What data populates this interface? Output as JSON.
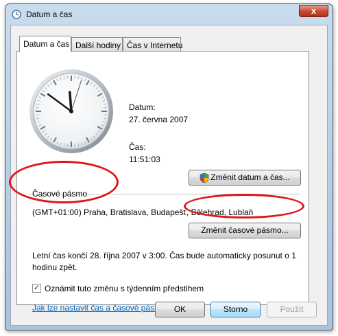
{
  "window": {
    "title": "Datum a čas",
    "close_glyph": "x"
  },
  "tabs": [
    {
      "label": "Datum a čas",
      "active": true
    },
    {
      "label": "Další hodiny",
      "active": false
    },
    {
      "label": "Čas v Internetu",
      "active": false
    }
  ],
  "clock": {
    "hour": 11,
    "minute": 51,
    "second": 3
  },
  "date": {
    "label": "Datum:",
    "value": "27. června 2007"
  },
  "time": {
    "label": "Čas:",
    "value": "11:51:03"
  },
  "change_datetime_button": "Změnit datum a čas...",
  "timezone": {
    "heading": "Časové pásmo",
    "value": "(GMT+01:00) Praha, Bratislava, Budapešť, Bělehrad, Lublaň",
    "change_button": "Změnit časové pásmo..."
  },
  "dst_notice": {
    "line1": "Letní čas končí 28. října 2007 v 3:00. Čas bude automaticky posunut o 1",
    "line2": "hodinu zpět."
  },
  "notify_checkbox": {
    "label": "Oznámit tuto změnu s týdenním předstihem",
    "checked": true,
    "check_glyph": "✓"
  },
  "help_link": "Jak lze nastavit čas a časové pásmo?",
  "dialog_buttons": {
    "ok": "OK",
    "cancel": "Storno",
    "apply": "Použít"
  },
  "colors": {
    "highlight_ellipse": "#e0141c",
    "link": "#0066cc",
    "clock_hands": "#1a1a1a"
  }
}
